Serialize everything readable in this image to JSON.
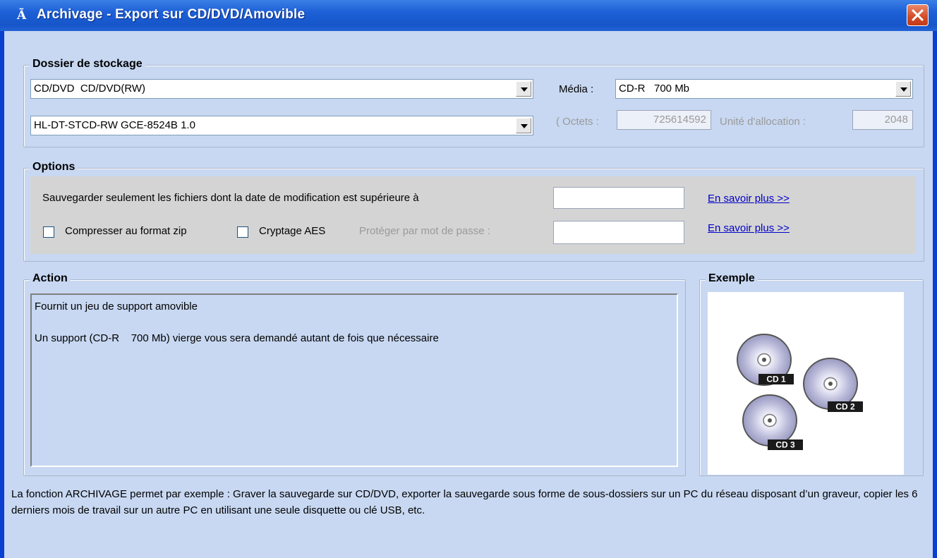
{
  "window": {
    "title": "Archivage - Export sur CD/DVD/Amovible",
    "title_icon": "archive-a-icon",
    "close_icon": "close-icon"
  },
  "storage": {
    "legend": "Dossier de stockage",
    "drive_type_value": "CD/DVD  CD/DVD(RW)",
    "device_value": "HL-DT-STCD-RW GCE-8524B 1.0",
    "media_label": "Média :",
    "media_value": "CD-R   700 Mb",
    "octets_label": "( Octets :",
    "octets_value": "725614592",
    "allocation_label": "Unité d'allocation :",
    "allocation_value": "2048"
  },
  "options": {
    "legend": "Options",
    "date_filter_label": "Sauvegarder seulement les fichiers dont la date de modification est supérieure à",
    "date_filter_value": "",
    "learn_more_1": "En savoir plus >>",
    "zip_label": "Compresser au format zip",
    "zip_checked": false,
    "aes_label": "Cryptage AES",
    "aes_checked": false,
    "password_label": "Protéger par mot de passe :",
    "password_value": "",
    "learn_more_2": "En savoir plus >>"
  },
  "action": {
    "legend": "Action",
    "line1": "Fournit un jeu de support amovible",
    "line2": "Un support (CD-R    700 Mb) vierge vous sera demandé autant de fois que nécessaire"
  },
  "example": {
    "legend": "Exemple",
    "discs": [
      "CD 1",
      "CD 2",
      "CD 3"
    ]
  },
  "footer": {
    "description": "La fonction ARCHIVAGE permet par exemple : Graver la sauvegarde sur CD/DVD, exporter la sauvegarde sous forme de sous-dossiers sur un PC du réseau disposant d’un graveur, copier les 6 derniers mois de travail sur un autre PC en utilisant une seule disquette ou clé USB, etc."
  }
}
